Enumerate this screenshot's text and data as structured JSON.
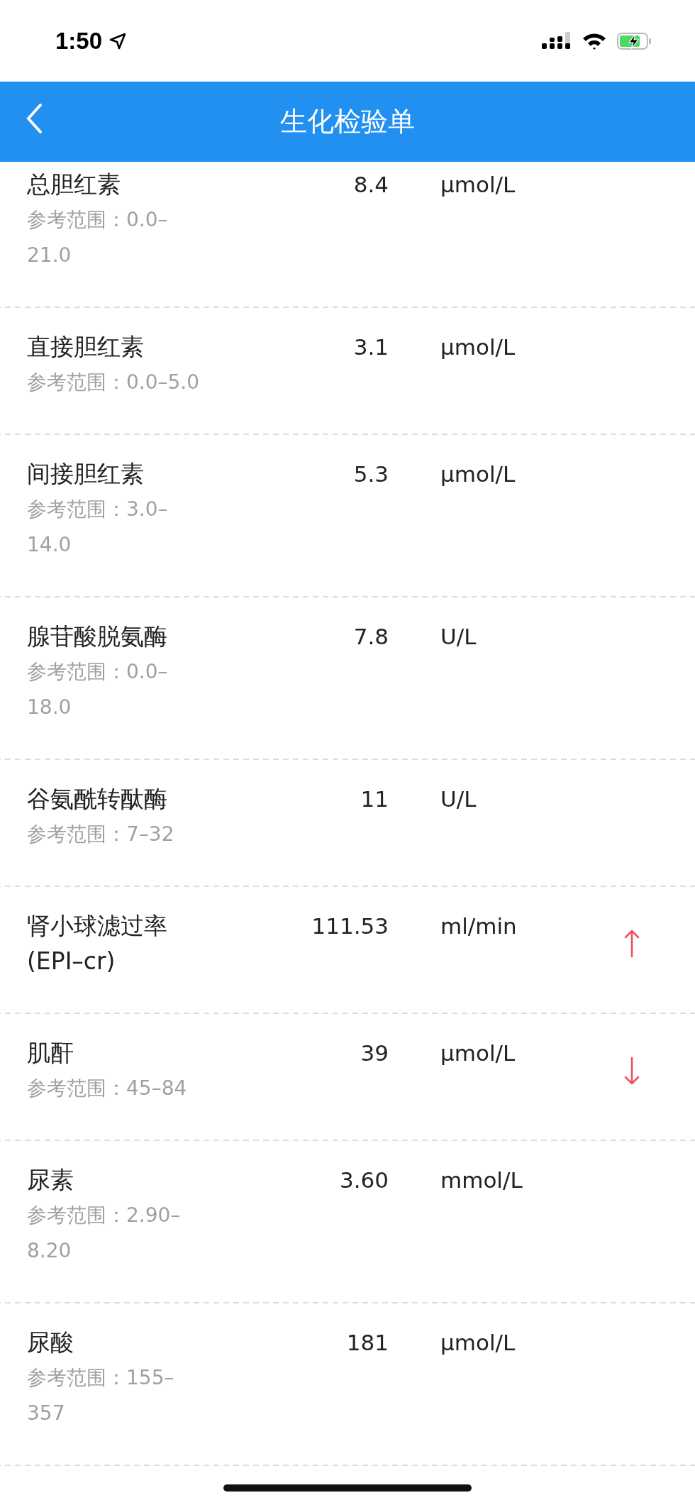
{
  "status_bar": {
    "time": "1:50"
  },
  "nav": {
    "title": "生化检验单"
  },
  "rows": [
    {
      "name": "总胆红素",
      "value": "8.4",
      "unit": "μmol/L",
      "range": "参考范围：0.0–21.0",
      "high": false,
      "low": false
    },
    {
      "name": "直接胆红素",
      "value": "3.1",
      "unit": "μmol/L",
      "range": "参考范围：0.0–5.0",
      "high": false,
      "low": false
    },
    {
      "name": "间接胆红素",
      "value": "5.3",
      "unit": "μmol/L",
      "range": "参考范围：3.0–14.0",
      "high": false,
      "low": false
    },
    {
      "name": "腺苷酸脱氨酶",
      "value": "7.8",
      "unit": "U/L",
      "range": "参考范围：0.0–18.0",
      "high": false,
      "low": false
    },
    {
      "name": "谷氨酰转酞酶",
      "value": "11",
      "unit": "U/L",
      "range": "参考范围：7–32",
      "high": false,
      "low": false
    },
    {
      "name": "肾小球滤过率(EPI–cr)",
      "value": "111.53",
      "unit": "ml/min",
      "high": true,
      "low": false
    },
    {
      "name": "肌酐",
      "value": "39",
      "unit": "μmol/L",
      "range": "参考范围：45–84",
      "high": false,
      "low": true
    },
    {
      "name": "尿素",
      "value": "3.60",
      "unit": "mmol/L",
      "range": "参考范围：2.90–8.20",
      "high": false,
      "low": false
    },
    {
      "name": "尿酸",
      "value": "181",
      "unit": "μmol/L",
      "range": "参考范围：155–357",
      "high": false,
      "low": false
    }
  ]
}
